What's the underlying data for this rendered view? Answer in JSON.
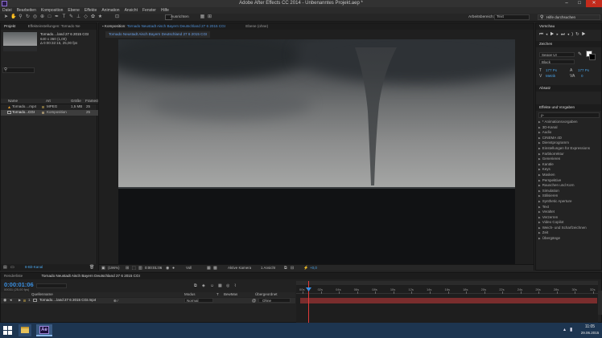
{
  "window": {
    "title": "Adobe After Effects CC 2014 - Unbenanntes Projekt.aep *",
    "min": "–",
    "max": "□",
    "close": "✕"
  },
  "menu": [
    "Datei",
    "Bearbeiten",
    "Komposition",
    "Ebene",
    "Effekte",
    "Animation",
    "Ansicht",
    "Fenster",
    "Hilfe"
  ],
  "toolbar": {
    "align_label": "Ausrichten",
    "workspace_label": "Arbeitsbereich:",
    "workspace_value": "Text",
    "help_placeholder": "Hilfe durchsuchen"
  },
  "project_panel": {
    "tab_project": "Projekt",
    "tab_effects": "Effekteinstellungen: Tornado Ne",
    "file_name": "Tornado....land 27 6 2015 CGI",
    "file_res": "640 x 360 (1,00)",
    "file_duration": "Δ 0:00:32:15, 25,00 fps",
    "columns": [
      "Name",
      "Art",
      "Größe",
      "Framera"
    ],
    "items": [
      {
        "name": "Tornado....mp4",
        "type": "MPEG",
        "size": "1,5 MB",
        "fps": "25"
      },
      {
        "name": "Tornado...CGI",
        "type": "Komposition",
        "size": "",
        "fps": "25"
      }
    ],
    "bpc": "8-Bit-Kanal"
  },
  "comp_panel": {
    "tab_label": "Komposition",
    "tab_name": "Tornado Neustadt Aisch Bayern Deutschland 27 6 2015 CGI",
    "layer_tab": "Ebene (ohne)",
    "sub_tab": "Tornado Neustadt Aisch Bayern Deutschland 27 6 2015 CGI",
    "zoom": "(196%)",
    "timecode": "0:00:01:06",
    "resolution": "Voll",
    "camera": "Aktive Kamera",
    "views": "1 Ansicht",
    "offset": "+0,0"
  },
  "right_panel": {
    "preview_tab": "Vorschau",
    "character_tab": "Zeichen",
    "font": "Segoe UI",
    "font_style": "Black",
    "font_size": "177 Px",
    "leading": "177 Px",
    "tracking": "Metrik",
    "tracking_val": "0",
    "paragraph_tab": "Absatz",
    "effects_tab": "Effekte und Vorgaben",
    "search_placeholder": "ρ-",
    "effects": [
      "* Animationsvorgaben",
      "3D-Kanal",
      "Audio",
      "CINEMA 4D",
      "Dienstprogramm",
      "Einstellungen für Expressions",
      "Farbkorrektur",
      "Generieren",
      "Kanäle",
      "Keys",
      "Masken",
      "Perspektive",
      "Rauschen und Korn",
      "Simulation",
      "Stilisieren",
      "Synthetic Aperture",
      "Text",
      "Veraltet",
      "Verzerren",
      "Video Copilot",
      "Weich- und Scharfzeichnen",
      "Zeit",
      "Übergänge"
    ]
  },
  "timeline": {
    "render_tab": "Renderliste",
    "comp_tab": "Tornado Neustadt Aisch Bayern Deutschland 27 6 2015 CGI",
    "timecode": "0:00:01:06",
    "frames": "00031 (25,00 fps)",
    "col_source": "Quellenname",
    "col_mode": "Modus",
    "col_t": "T",
    "col_trkmat": "BewMas",
    "col_parent": "Übergeordnet",
    "layer_num": "1",
    "layer_name": "Tornado....land 27 6 2015 CGI.mp4",
    "layer_mode": "Normal",
    "layer_parent": "Ohne",
    "ruler": [
      "00s",
      "02s",
      "04s",
      "06s",
      "08s",
      "10s",
      "12s",
      "14s",
      "16s",
      "18s",
      "20s",
      "22s",
      "24s",
      "26s",
      "28s",
      "30s",
      "32s"
    ]
  },
  "taskbar": {
    "time": "11:05",
    "date": "29.06.2015",
    "ae": "Ae"
  },
  "colors": {
    "accent": "#4e8fd6",
    "timecode": "#3a8fe0",
    "taskbar": "#1d3550"
  }
}
